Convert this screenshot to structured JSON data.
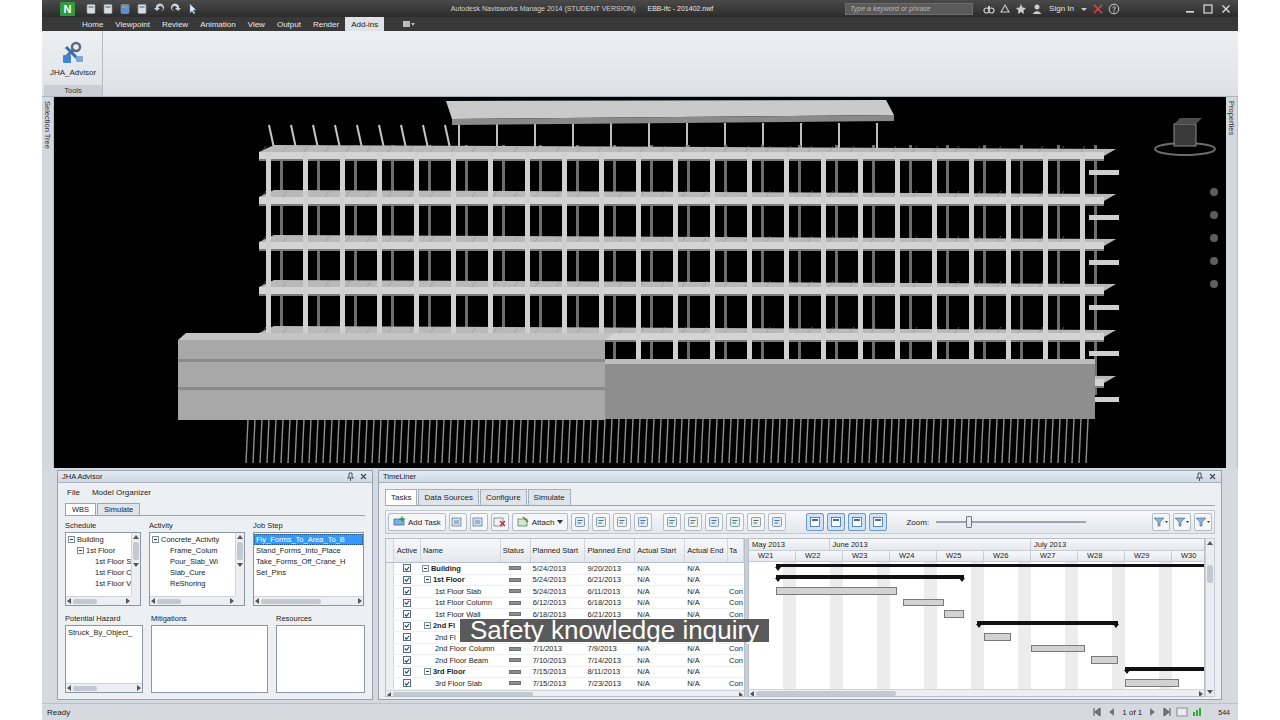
{
  "window": {
    "logo": "N",
    "title": "Autodesk Navisworks Manage 2014 (STUDENT VERSION)",
    "file": "EBB-ifc - 201402.nwf"
  },
  "search": {
    "placeholder": "Type a keyword or phrase"
  },
  "account": {
    "label": "Sign In"
  },
  "ribbon_tabs": [
    {
      "label": "Home",
      "selected": false
    },
    {
      "label": "Viewpoint",
      "selected": false
    },
    {
      "label": "Review",
      "selected": false
    },
    {
      "label": "Animation",
      "selected": false
    },
    {
      "label": "View",
      "selected": false
    },
    {
      "label": "Output",
      "selected": false
    },
    {
      "label": "Render",
      "selected": false
    },
    {
      "label": "Add-ins",
      "selected": true
    }
  ],
  "ribbon": {
    "tools": [
      {
        "label": "JHA_Advisor"
      }
    ],
    "group": "Tools"
  },
  "side_tabs": {
    "left": "Selection Tree",
    "right": "Properties"
  },
  "jha_advisor": {
    "title": "JHA Advisor",
    "menu": [
      "File",
      "Model Organizer"
    ],
    "tabs": [
      {
        "label": "WBS",
        "selected": true
      },
      {
        "label": "Simulate",
        "selected": false
      }
    ],
    "schedule": {
      "label": "Schedule",
      "items": [
        {
          "text": "Building",
          "kind": "node",
          "depth": 0,
          "expanded": true
        },
        {
          "text": "1st Floor",
          "kind": "node",
          "depth": 1,
          "expanded": true
        },
        {
          "text": "1st Floor S",
          "kind": "leaf",
          "depth": 2,
          "expanded": false
        },
        {
          "text": "1st Floor C",
          "kind": "leaf",
          "depth": 2,
          "expanded": false
        },
        {
          "text": "1st Floor V",
          "kind": "leaf",
          "depth": 2,
          "expanded": false
        }
      ]
    },
    "activity": {
      "label": "Activity",
      "items": [
        {
          "text": "Concrete_Activity",
          "kind": "node",
          "depth": 0,
          "expanded": true
        },
        {
          "text": "Frame_Colum",
          "kind": "leaf",
          "depth": 1,
          "expanded": false
        },
        {
          "text": "Pour_Slab_Wi",
          "kind": "leaf",
          "depth": 1,
          "expanded": false
        },
        {
          "text": "Slab_Cure",
          "kind": "leaf",
          "depth": 1,
          "expanded": false
        },
        {
          "text": "ReShoring",
          "kind": "leaf",
          "depth": 1,
          "expanded": false
        }
      ]
    },
    "job_step": {
      "label": "Job Step",
      "items": [
        {
          "text": "Fly_Forms_To_Area_To_B",
          "selected": true
        },
        {
          "text": "Stand_Forms_Into_Place",
          "selected": false
        },
        {
          "text": "Take_Forms_Off_Crane_H",
          "selected": false
        },
        {
          "text": "Set_Pins",
          "selected": false
        }
      ]
    },
    "potential_hazard": {
      "label": "Potential Hazard",
      "items": [
        "Struck_By_Object_"
      ]
    },
    "mitigations": {
      "label": "Mitigations",
      "items": []
    },
    "resources": {
      "label": "Resources",
      "items": []
    }
  },
  "timeliner": {
    "title": "TimeLiner",
    "tabs": [
      {
        "label": "Tasks",
        "selected": true
      },
      {
        "label": "Data Sources",
        "selected": false
      },
      {
        "label": "Configure",
        "selected": false
      },
      {
        "label": "Simulate",
        "selected": false
      }
    ],
    "toolbar": {
      "add_task": "Add Task",
      "attach": "Attach",
      "zoom_label": "Zoom:",
      "zoom_level": 0.22
    },
    "columns": [
      "Active",
      "Name",
      "Status",
      "Planned Start",
      "Planned End",
      "Actual Start",
      "Actual End",
      "Ta"
    ],
    "gantt": {
      "months": [
        "May 2013",
        "June 2013",
        "July 2013"
      ],
      "weeks": [
        "W21",
        "W22",
        "W23",
        "W24",
        "W25",
        "W26",
        "W27",
        "W28",
        "W29",
        "W30"
      ]
    },
    "rows": [
      {
        "name": "Building",
        "kind": "summary",
        "depth": 0,
        "expanded": true,
        "active": true,
        "planned_start": "5/24/2013",
        "planned_end": "9/20/2013",
        "actual_start": "N/A",
        "actual_end": "N/A",
        "type": "",
        "bar": [
          4,
          123
        ]
      },
      {
        "name": "1st Floor",
        "kind": "summary",
        "depth": 1,
        "expanded": true,
        "active": true,
        "planned_start": "5/24/2013",
        "planned_end": "6/21/2013",
        "actual_start": "N/A",
        "actual_end": "N/A",
        "type": "",
        "bar": [
          4,
          32
        ]
      },
      {
        "name": "1st Floor Slab",
        "kind": "task",
        "depth": 2,
        "expanded": false,
        "active": true,
        "planned_start": "5/24/2013",
        "planned_end": "6/11/2013",
        "actual_start": "N/A",
        "actual_end": "N/A",
        "type": "Con",
        "bar": [
          4,
          22
        ]
      },
      {
        "name": "1st Floor Column",
        "kind": "task",
        "depth": 2,
        "expanded": false,
        "active": true,
        "planned_start": "6/12/2013",
        "planned_end": "6/18/2013",
        "actual_start": "N/A",
        "actual_end": "N/A",
        "type": "Con",
        "bar": [
          23,
          29
        ]
      },
      {
        "name": "1st Floor Wall",
        "kind": "task",
        "depth": 2,
        "expanded": false,
        "active": true,
        "planned_start": "6/18/2013",
        "planned_end": "6/21/2013",
        "actual_start": "N/A",
        "actual_end": "N/A",
        "type": "Con",
        "bar": [
          29,
          32
        ]
      },
      {
        "name": "2nd Fl",
        "kind": "summary",
        "depth": 1,
        "expanded": true,
        "active": true,
        "planned_start": "",
        "planned_end": "",
        "actual_start": "",
        "actual_end": "",
        "type": "",
        "bar": [
          34,
          55
        ]
      },
      {
        "name": "2nd Fl",
        "kind": "task",
        "depth": 2,
        "expanded": false,
        "active": true,
        "planned_start": "",
        "planned_end": "",
        "actual_start": "",
        "actual_end": "",
        "type": "",
        "bar": [
          35,
          39
        ]
      },
      {
        "name": "2nd Floor Column",
        "kind": "task",
        "depth": 2,
        "expanded": false,
        "active": true,
        "planned_start": "7/1/2013",
        "planned_end": "7/9/2013",
        "actual_start": "N/A",
        "actual_end": "N/A",
        "type": "Con",
        "bar": [
          42,
          50
        ]
      },
      {
        "name": "2nd Floor Beam",
        "kind": "task",
        "depth": 2,
        "expanded": false,
        "active": true,
        "planned_start": "7/10/2013",
        "planned_end": "7/14/2013",
        "actual_start": "N/A",
        "actual_end": "N/A",
        "type": "Con",
        "bar": [
          51,
          55
        ]
      },
      {
        "name": "3rd Floor",
        "kind": "summary",
        "depth": 1,
        "expanded": true,
        "active": true,
        "planned_start": "7/15/2013",
        "planned_end": "8/11/2013",
        "actual_start": "N/A",
        "actual_end": "N/A",
        "type": "",
        "bar": [
          56,
          83
        ]
      },
      {
        "name": "3rd Floor Slab",
        "kind": "task",
        "depth": 2,
        "expanded": false,
        "active": true,
        "planned_start": "7/15/2013",
        "planned_end": "7/23/2013",
        "actual_start": "N/A",
        "actual_end": "N/A",
        "type": "Con",
        "bar": [
          56,
          64
        ]
      }
    ]
  },
  "caption": "Safety knowledge inquiry",
  "status_bar": {
    "text": "Ready",
    "page": "1 of 1",
    "memory": "544"
  }
}
